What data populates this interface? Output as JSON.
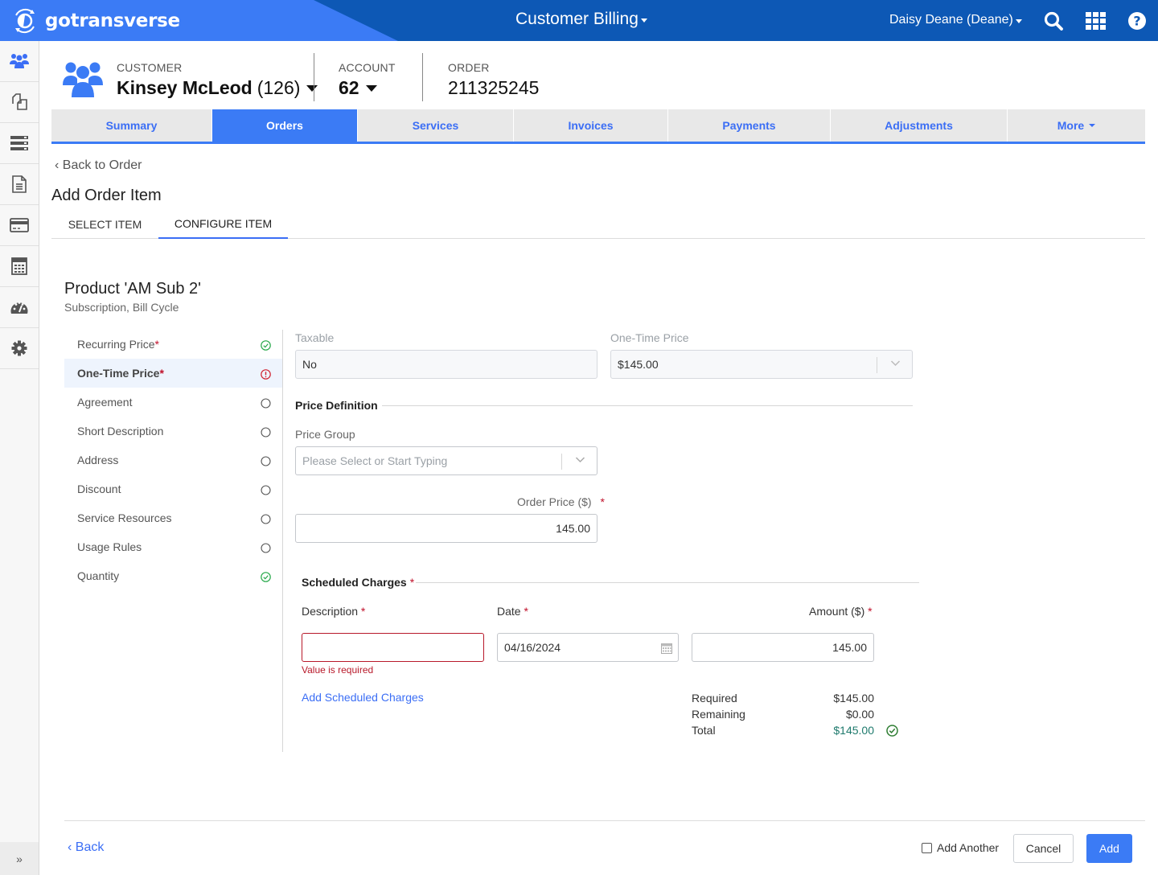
{
  "topbar": {
    "brand": "gotransverse",
    "app_title": "Customer Billing",
    "user": "Daisy Deane (Deane)",
    "icons": [
      "search-icon",
      "apps-grid-icon",
      "help-icon"
    ]
  },
  "leftnav": {
    "items": [
      {
        "icon": "customers-icon",
        "active": true
      },
      {
        "icon": "copy-documents-icon"
      },
      {
        "icon": "list-server-icon"
      },
      {
        "icon": "document-icon"
      },
      {
        "icon": "credit-card-icon"
      },
      {
        "icon": "calculator-icon"
      },
      {
        "icon": "dashboard-gauge-icon"
      },
      {
        "icon": "gear-icon"
      }
    ],
    "expand_glyph": "»"
  },
  "header": {
    "customer_label": "CUSTOMER",
    "customer_name": "Kinsey McLeod",
    "customer_id": "(126)",
    "account_label": "ACCOUNT",
    "account_value": "62",
    "order_label": "ORDER",
    "order_value": "211325245"
  },
  "tabs": [
    {
      "label": "Summary"
    },
    {
      "label": "Orders",
      "active": true
    },
    {
      "label": "Services"
    },
    {
      "label": "Invoices"
    },
    {
      "label": "Payments"
    },
    {
      "label": "Adjustments"
    },
    {
      "label": "More"
    }
  ],
  "page": {
    "back_link": "Back to Order",
    "title": "Add Order Item",
    "subtabs": [
      {
        "label": "SELECT ITEM"
      },
      {
        "label": "CONFIGURE ITEM",
        "active": true
      }
    ]
  },
  "product": {
    "title": "Product 'AM Sub 2'",
    "subtitle": "Subscription, Bill Cycle"
  },
  "steps": [
    {
      "label": "Recurring Price",
      "required": "*",
      "status": "complete"
    },
    {
      "label": "One-Time Price",
      "required": "*",
      "status": "error",
      "active": true
    },
    {
      "label": "Agreement",
      "status": "empty"
    },
    {
      "label": "Short Description",
      "status": "empty"
    },
    {
      "label": "Address",
      "status": "empty"
    },
    {
      "label": "Discount",
      "status": "empty"
    },
    {
      "label": "Service Resources",
      "status": "empty"
    },
    {
      "label": "Usage Rules",
      "status": "empty"
    },
    {
      "label": "Quantity",
      "status": "complete"
    }
  ],
  "form": {
    "taxable_label": "Taxable",
    "taxable_value": "No",
    "one_time_price_label": "One-Time Price",
    "one_time_price_value": "$145.00",
    "price_definition_title": "Price Definition",
    "price_group_label": "Price Group",
    "price_group_placeholder": "Please Select or Start Typing",
    "order_price_label": "Order Price ($)",
    "order_price_value": "145.00",
    "required_star": "*",
    "scheduled_charges_title": "Scheduled Charges",
    "description_label": "Description",
    "description_value": "",
    "description_error": "Value is required",
    "date_label": "Date",
    "date_value": "04/16/2024",
    "amount_label": "Amount ($)",
    "amount_value": "145.00",
    "add_charges_link": "Add Scheduled Charges",
    "summary": {
      "required_label": "Required",
      "required_value": "$145.00",
      "remaining_label": "Remaining",
      "remaining_value": "$0.00",
      "total_label": "Total",
      "total_value": "$145.00"
    }
  },
  "footer": {
    "back_label": "Back",
    "add_another_label": "Add Another",
    "add_another_checked": false,
    "cancel_label": "Cancel",
    "add_label": "Add"
  },
  "colors": {
    "primary": "#3b7bf5",
    "topbar": "#0d58b5",
    "error": "#b8192a",
    "success": "#27a84a"
  }
}
